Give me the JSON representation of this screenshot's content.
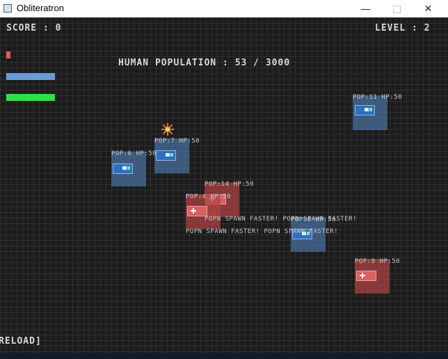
{
  "window": {
    "title": "Obliteratron",
    "minimize": "—",
    "close": "✕"
  },
  "hud": {
    "score": "SCORE : 0",
    "level": "LEVEL : 2",
    "population": "HUMAN POPULATION : 53 / 3000",
    "reload": "RELOAD]"
  },
  "units": [
    {
      "label": "POP:11  HP:50",
      "team": "blue"
    },
    {
      "label": "POP:7  HP:50",
      "team": "blue"
    },
    {
      "label": "POP:6  HP:50",
      "team": "blue"
    },
    {
      "label": "POP:14  HP:50",
      "team": "red"
    },
    {
      "label": "POP:4  HP:50",
      "team": "red"
    },
    {
      "label": "POP:8  HP:50",
      "team": "blue"
    },
    {
      "label": "POP:9  HP:50",
      "team": "red"
    }
  ],
  "messages": [
    "POPN SPAWN FASTER! POPN SPAWN FASTER!",
    "POPN SPAWN FASTER! POPN SPAWN FASTER!"
  ],
  "colors": {
    "health_bar": "#e25b5b",
    "ammo_bar": "#6b9bd6",
    "energy_bar": "#2ee046",
    "blue_team": "#4a70a0",
    "red_team": "#b24242"
  }
}
